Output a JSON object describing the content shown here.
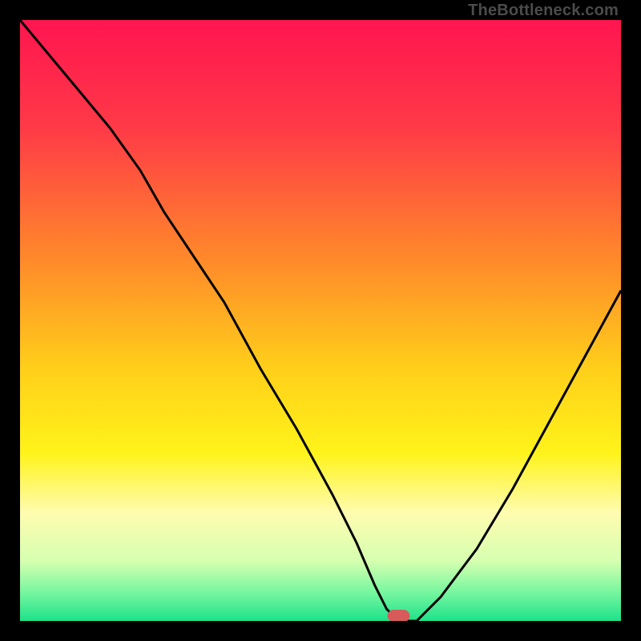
{
  "watermark": "TheBottleneck.com",
  "marker": {
    "x_pct": 63,
    "color": "#d85a5a"
  },
  "gradient_stops": [
    {
      "offset": 0,
      "color": "#ff1550"
    },
    {
      "offset": 0.18,
      "color": "#ff3a47"
    },
    {
      "offset": 0.4,
      "color": "#ff8a2a"
    },
    {
      "offset": 0.58,
      "color": "#ffcf1a"
    },
    {
      "offset": 0.72,
      "color": "#fff31a"
    },
    {
      "offset": 0.82,
      "color": "#fffcb0"
    },
    {
      "offset": 0.9,
      "color": "#d6ffb0"
    },
    {
      "offset": 0.95,
      "color": "#7bf7a0"
    },
    {
      "offset": 1.0,
      "color": "#1de28a"
    }
  ],
  "chart_data": {
    "type": "line",
    "title": "",
    "xlabel": "",
    "ylabel": "",
    "xlim": [
      0,
      100
    ],
    "ylim": [
      0,
      100
    ],
    "x": [
      0,
      5,
      10,
      15,
      20,
      24,
      28,
      34,
      40,
      46,
      52,
      56,
      59,
      61,
      63,
      66,
      70,
      76,
      82,
      88,
      94,
      100
    ],
    "y": [
      100,
      94,
      88,
      82,
      75,
      68,
      62,
      53,
      42,
      32,
      21,
      13,
      6,
      2,
      0,
      0,
      4,
      12,
      22,
      33,
      44,
      55
    ],
    "optimal_x_pct": 63
  }
}
